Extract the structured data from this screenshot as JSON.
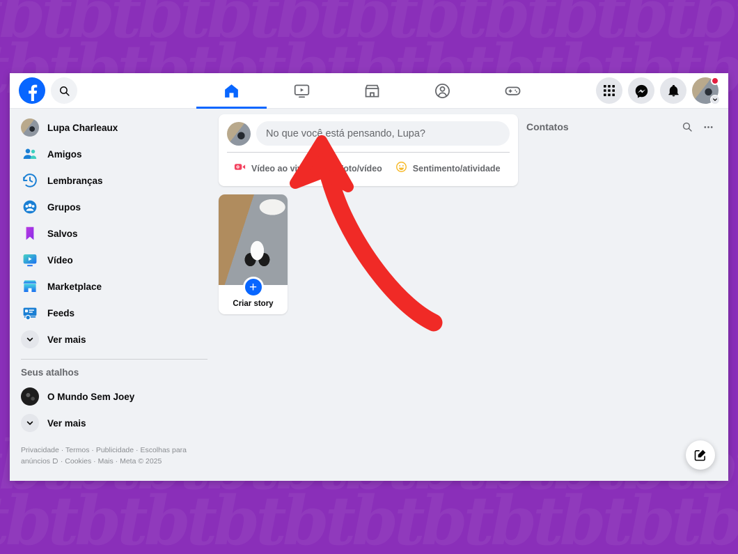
{
  "window": {
    "app": "Facebook"
  },
  "topbar": {
    "logo_icon": "facebook-logo-icon",
    "search_icon": "search-icon",
    "nav": [
      {
        "name": "home",
        "icon": "home-icon",
        "active": true
      },
      {
        "name": "video",
        "icon": "video-icon",
        "active": false
      },
      {
        "name": "marketplace",
        "icon": "marketplace-icon",
        "active": false
      },
      {
        "name": "groups",
        "icon": "groups-icon",
        "active": false
      },
      {
        "name": "gaming",
        "icon": "gaming-icon",
        "active": false
      }
    ],
    "actions": [
      {
        "name": "menu-grid",
        "icon": "grid-menu-icon"
      },
      {
        "name": "messenger",
        "icon": "messenger-icon"
      },
      {
        "name": "notifications",
        "icon": "bell-icon"
      }
    ],
    "account": {
      "avatar_icon": "user-avatar",
      "has_notification_badge": true,
      "chevron_icon": "chevron-down-icon"
    }
  },
  "sidebar": {
    "items": [
      {
        "label": "Lupa Charleaux",
        "icon": "user-avatar"
      },
      {
        "label": "Amigos",
        "icon": "friends-icon"
      },
      {
        "label": "Lembranças",
        "icon": "memories-clock-icon"
      },
      {
        "label": "Grupos",
        "icon": "groups-icon"
      },
      {
        "label": "Salvos",
        "icon": "bookmark-icon"
      },
      {
        "label": "Vídeo",
        "icon": "video-play-icon"
      },
      {
        "label": "Marketplace",
        "icon": "marketplace-store-icon"
      },
      {
        "label": "Feeds",
        "icon": "feeds-icon"
      },
      {
        "label": "Ver mais",
        "icon": "chevron-down-icon"
      }
    ],
    "shortcuts_heading": "Seus atalhos",
    "shortcuts": [
      {
        "label": "O Mundo Sem Joey",
        "icon": "page-avatar"
      }
    ],
    "shortcuts_more": {
      "label": "Ver mais",
      "icon": "chevron-down-icon"
    },
    "footer": {
      "links": [
        "Privacidade",
        "Termos",
        "Publicidade",
        "Escolhas para anúncios",
        "Cookies",
        "Mais"
      ],
      "ad_choices_icon": "ad-choices-icon",
      "copyright": "Meta © 2025",
      "separator": "·"
    }
  },
  "feed": {
    "composer": {
      "avatar_icon": "user-avatar",
      "placeholder": "No que você está pensando, Lupa?",
      "value": "",
      "actions": [
        {
          "label": "Vídeo ao vivo",
          "icon": "live-video-icon",
          "color": "#f3425f"
        },
        {
          "label": "Foto/vídeo",
          "icon": "photo-video-icon",
          "color": "#45bd62"
        },
        {
          "label": "Sentimento/atividade",
          "icon": "emoji-smiley-icon",
          "color": "#f7b928"
        }
      ]
    },
    "stories": [
      {
        "label": "Criar story",
        "plus": "+",
        "plus_icon": "plus-icon",
        "thumb": "cat-photo"
      }
    ]
  },
  "contacts": {
    "title": "Contatos",
    "search_icon": "search-icon",
    "more_icon": "more-horizontal-icon"
  },
  "fab": {
    "icon": "compose-edit-icon"
  },
  "annotation": {
    "arrow_color": "#f02a26",
    "points_to": "composer-input"
  },
  "background": {
    "color": "#8a2fb9",
    "watermark_text": "tbtbtbtbtbtbtbtbtbtbtbtbtbtbtbtb"
  },
  "colors": {
    "brand_blue": "#0866ff",
    "page_bg": "#f0f2f5",
    "card_bg": "#ffffff",
    "text_primary": "#080809",
    "text_secondary": "#65676b",
    "badge_red": "#e41e3f"
  }
}
